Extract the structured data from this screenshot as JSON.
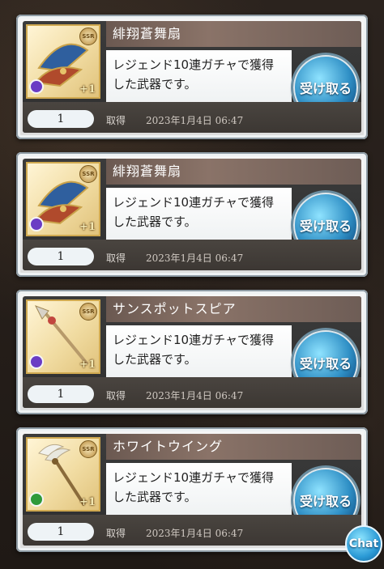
{
  "items": [
    {
      "name": "緋翔蒼舞扇",
      "description": "レジェンド10連ガチャで獲得した武器です。",
      "quantity": "1",
      "acquired_label": "取得",
      "acquired_date": "2023年1月4日 06:47",
      "receive_label": "受け取る",
      "plus": "+1",
      "rarity": "SSR",
      "weapon_icon": "fan-icon",
      "element_color": "#6a3cc4"
    },
    {
      "name": "緋翔蒼舞扇",
      "description": "レジェンド10連ガチャで獲得した武器です。",
      "quantity": "1",
      "acquired_label": "取得",
      "acquired_date": "2023年1月4日 06:47",
      "receive_label": "受け取る",
      "plus": "+1",
      "rarity": "SSR",
      "weapon_icon": "fan-icon",
      "element_color": "#6a3cc4"
    },
    {
      "name": "サンスポットスピア",
      "description": "レジェンド10連ガチャで獲得した武器です。",
      "quantity": "1",
      "acquired_label": "取得",
      "acquired_date": "2023年1月4日 06:47",
      "receive_label": "受け取る",
      "plus": "+1",
      "rarity": "SSR",
      "weapon_icon": "spear-icon",
      "element_color": "#6a3cc4"
    },
    {
      "name": "ホワイトウイング",
      "description": "レジェンド10連ガチャで獲得した武器です。",
      "quantity": "1",
      "acquired_label": "取得",
      "acquired_date": "2023年1月4日 06:47",
      "receive_label": "受け取る",
      "plus": "+1",
      "rarity": "SSR",
      "weapon_icon": "staff-icon",
      "element_color": "#2f9a3a"
    }
  ],
  "chat_label": "Chat"
}
